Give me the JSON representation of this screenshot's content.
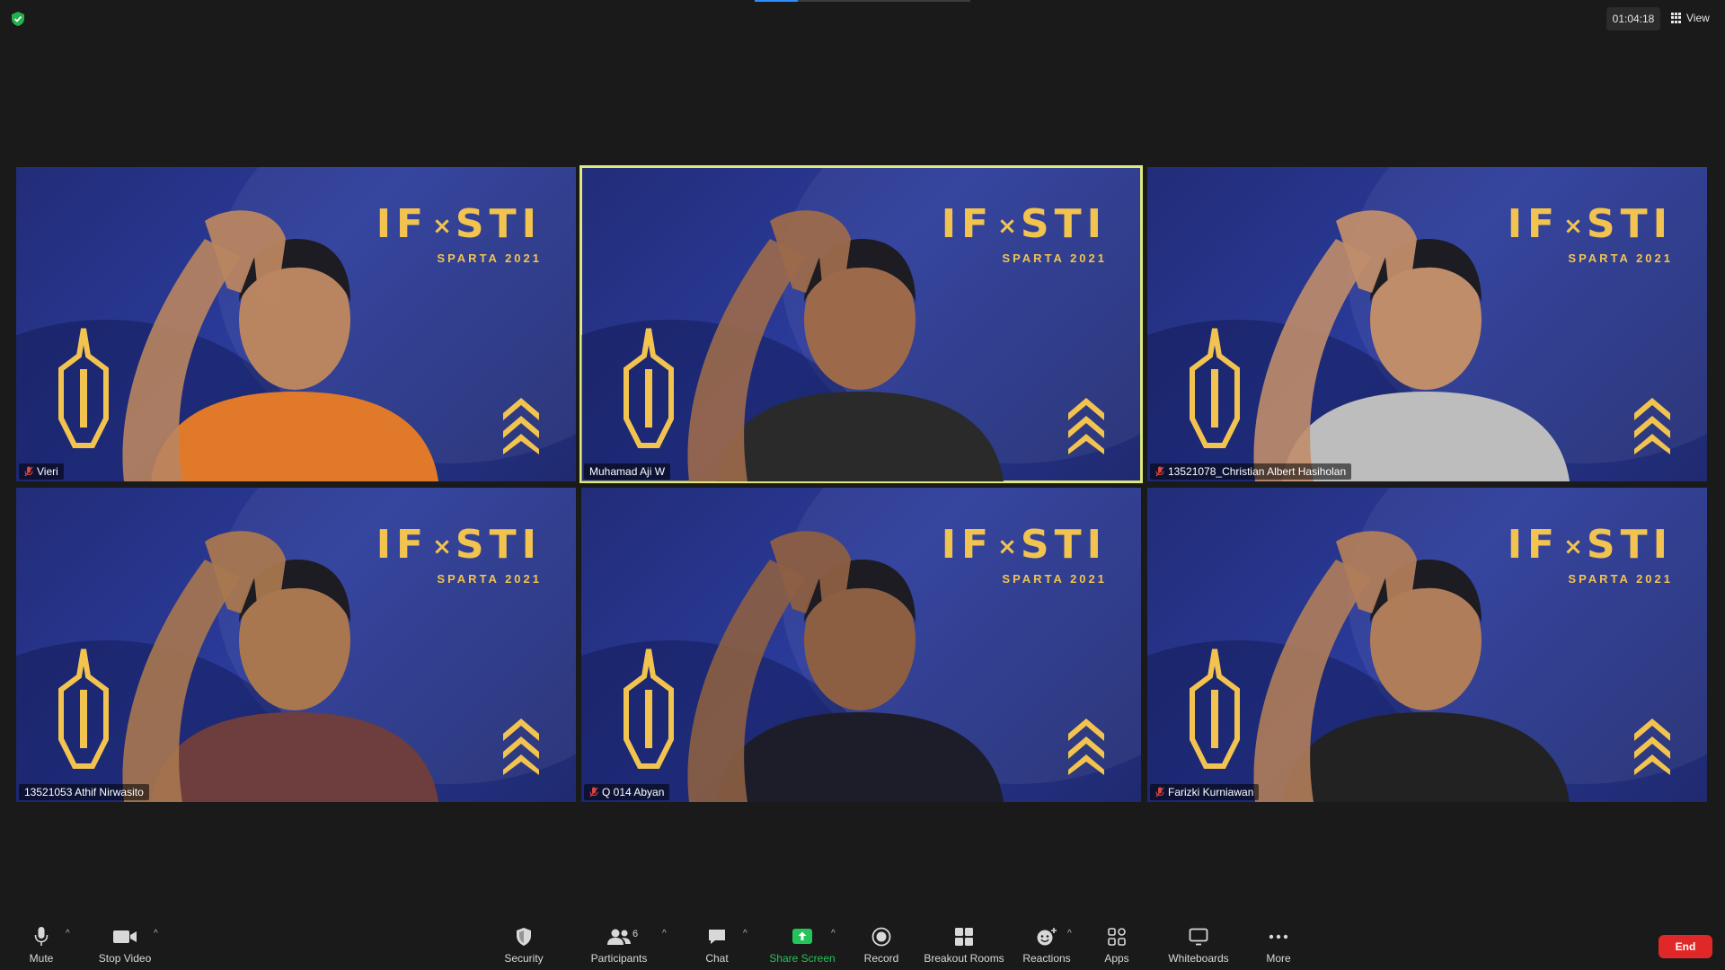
{
  "top": {
    "timer": "01:04:18",
    "view_label": "View"
  },
  "brand": {
    "title_left": "IF",
    "title_x": "×",
    "title_right": "STI",
    "subtitle": "SPARTA 2021"
  },
  "participants": [
    {
      "name": "Vieri",
      "muted": true
    },
    {
      "name": "Muhamad Aji W",
      "muted": false,
      "speaking": true
    },
    {
      "name": "13521078_Christian Albert Hasiholan",
      "muted": true
    },
    {
      "name": "13521053 Athif Nirwasito",
      "muted": false
    },
    {
      "name": "Q 014 Abyan",
      "muted": true
    },
    {
      "name": "Farizki Kurniawan",
      "muted": true
    }
  ],
  "toolbar": {
    "mute": "Mute",
    "stop_video": "Stop Video",
    "security": "Security",
    "participants": "Participants",
    "participants_count": "6",
    "chat": "Chat",
    "share_screen": "Share Screen",
    "record": "Record",
    "breakout_rooms": "Breakout Rooms",
    "reactions": "Reactions",
    "apps": "Apps",
    "whiteboards": "Whiteboards",
    "more": "More",
    "end": "End"
  },
  "colors": {
    "background": "#1a1a1a",
    "tile_blue": "#2a3a99",
    "brand_gold": "#f2c44f",
    "active_speaker": "#dfe87c",
    "share_green": "#24c45a",
    "end_red": "#e02828",
    "muted_red": "#e0453a"
  }
}
